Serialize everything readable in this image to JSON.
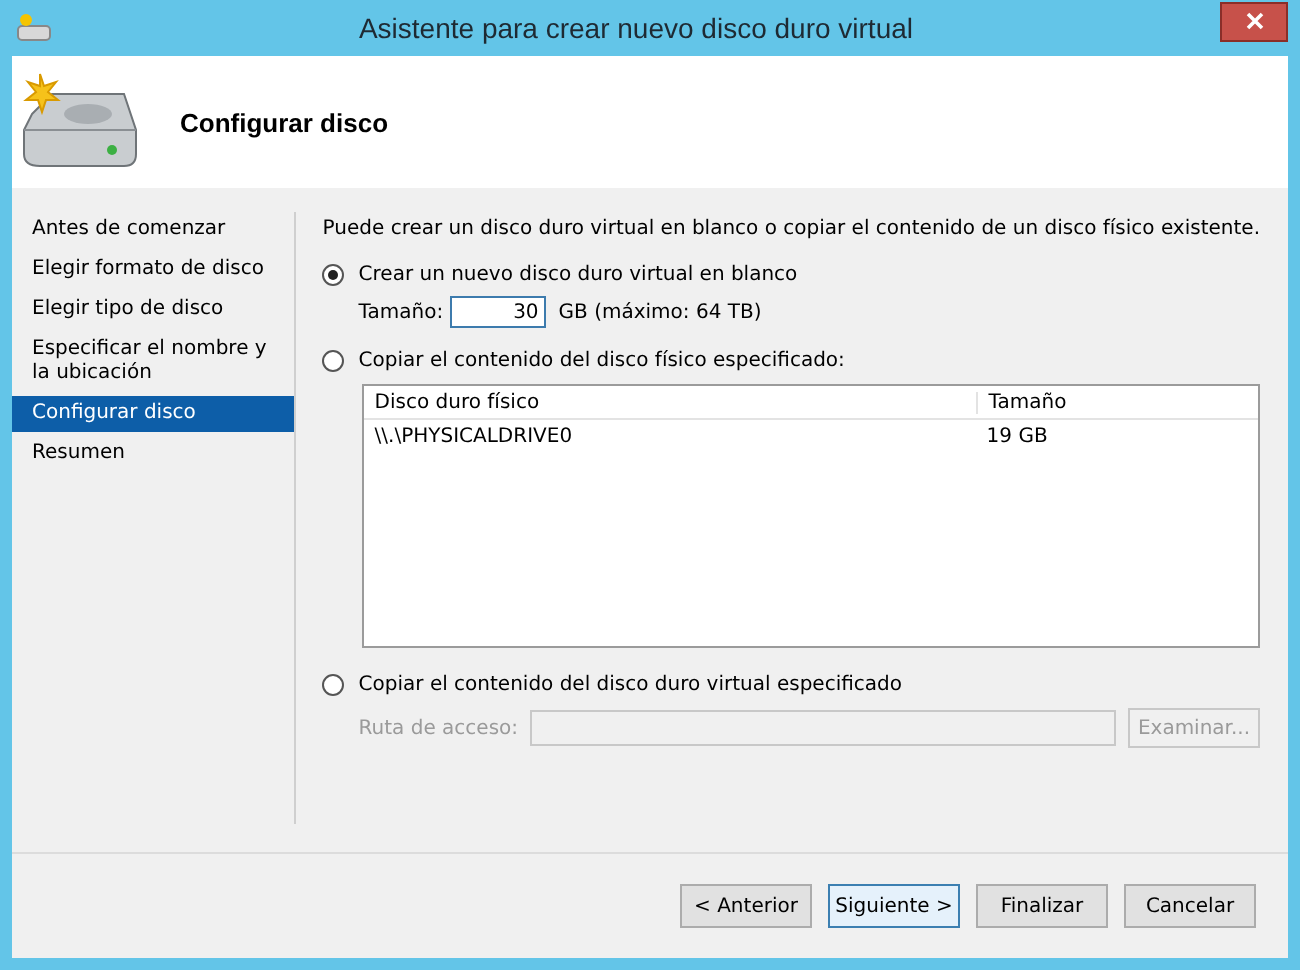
{
  "window": {
    "title": "Asistente para crear nuevo disco duro virtual"
  },
  "header": {
    "title": "Configurar disco"
  },
  "sidebar": {
    "items": [
      {
        "label": "Antes de comenzar",
        "selected": false
      },
      {
        "label": "Elegir formato de disco",
        "selected": false
      },
      {
        "label": "Elegir tipo de disco",
        "selected": false
      },
      {
        "label": "Especificar el nombre y la ubicación",
        "selected": false
      },
      {
        "label": "Configurar disco",
        "selected": true
      },
      {
        "label": "Resumen",
        "selected": false
      }
    ]
  },
  "intro": "Puede crear un disco duro virtual en blanco o copiar el contenido de un disco físico existente.",
  "option_new": {
    "label": "Crear un nuevo disco duro virtual en blanco",
    "selected": true,
    "size_label": "Tamaño:",
    "size_value": "30",
    "size_unit": "GB (máximo: 64 TB)"
  },
  "option_physical": {
    "label": "Copiar el contenido del disco físico especificado:",
    "selected": false,
    "table": {
      "columns": [
        "Disco duro físico",
        "Tamaño"
      ],
      "rows": [
        [
          "\\\\.\\PHYSICALDRIVE0",
          "19 GB"
        ]
      ]
    }
  },
  "option_virtual": {
    "label": "Copiar el contenido del disco duro virtual especificado",
    "selected": false,
    "path_label": "Ruta de acceso:",
    "path_disabled": true,
    "browse": {
      "label": "Examinar...",
      "disabled": true
    }
  },
  "buttons": [
    {
      "label": "< Anterior",
      "default": false,
      "disabled": false
    },
    {
      "label": "Siguiente >",
      "default": true,
      "disabled": false
    },
    {
      "label": "Finalizar",
      "default": false,
      "disabled": false
    },
    {
      "label": "Cancelar",
      "default": false,
      "disabled": false
    }
  ]
}
